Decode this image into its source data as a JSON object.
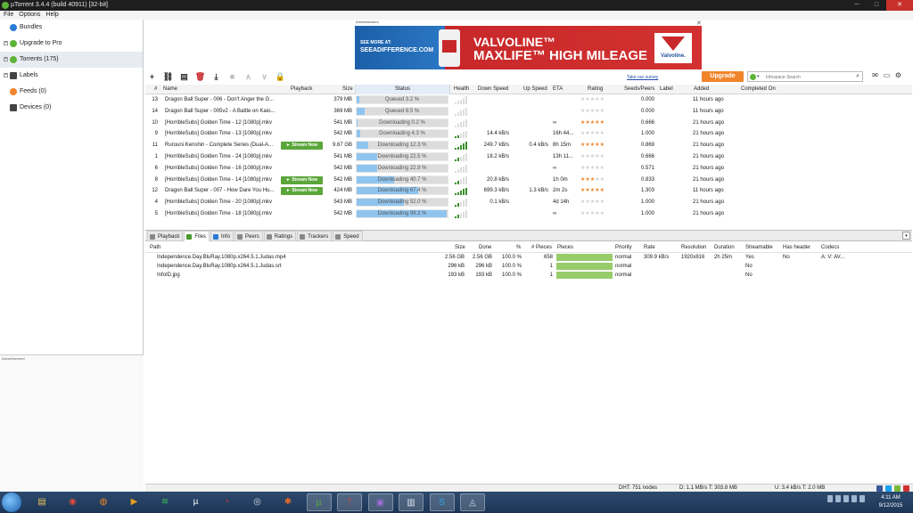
{
  "window": {
    "title": "µTorrent 3.4.4  (build 40911) [32-bit]",
    "min": "─",
    "max": "□",
    "close": "✕"
  },
  "menu": [
    "File",
    "Options",
    "Help"
  ],
  "sidebar": {
    "items": [
      {
        "label": "Bundles",
        "icon_color": "#2a7bd6"
      },
      {
        "label": "Upgrade to Pro",
        "icon_color": "#5cb338"
      },
      {
        "label": "Torrents (175)",
        "icon_color": "#5cb338"
      },
      {
        "label": "Labels",
        "icon_color": "#444444"
      },
      {
        "label": "Feeds (0)",
        "icon_color": "#f0852b"
      },
      {
        "label": "Devices (0)",
        "icon_color": "#444444"
      }
    ],
    "ad_label": "Advertisement"
  },
  "ad": {
    "label": "Advertisement",
    "close": "✕",
    "see_more": "SEE MORE AT:",
    "url": "SEEADIFFERENCE.COM",
    "brand": "VALVOLINE™",
    "tagline": "MAXLIFE™ HIGH MILEAGE",
    "logo": "Valvoline."
  },
  "survey_link": "Take our survey",
  "upgrade_button": "Upgrade",
  "search": {
    "placeholder": "Infospace Search"
  },
  "toolbar": {
    "icons": [
      "add-torrent-icon",
      "add-url-icon",
      "create-torrent-icon",
      "remove-icon",
      "download-icon",
      "stop-icon",
      "move-up-icon",
      "move-down-icon",
      "lock-icon"
    ]
  },
  "torrents": {
    "columns": [
      "#",
      "Name",
      "Playback",
      "Size",
      "Status",
      "Health",
      "Down Speed",
      "Up Speed",
      "ETA",
      "Rating",
      "Seeds/Peers",
      "Label",
      "Added",
      "Completed On"
    ],
    "stream_label": "► Stream Now",
    "rows": [
      {
        "num": "13",
        "name": "Dragon Ball Super - 006 - Don't Anger the G...",
        "stream": false,
        "size": "379 MB",
        "status": "Queued 3.2 %",
        "progress": 3.2,
        "health": 0,
        "down": "",
        "up": "",
        "eta": "",
        "rating": 0,
        "seeds": "0.000",
        "added": "11 hours ago"
      },
      {
        "num": "14",
        "name": "Dragon Ball Super - 005v2 - A Battle on Kaio...",
        "stream": false,
        "size": "369 MB",
        "status": "Queued 8.5 %",
        "progress": 8.5,
        "health": 0,
        "down": "",
        "up": "",
        "eta": "",
        "rating": 0,
        "seeds": "0.000",
        "added": "11 hours ago"
      },
      {
        "num": "10",
        "name": "[HorribleSubs] Golden Time - 12 [1080p].mkv",
        "stream": false,
        "size": "541 MB",
        "status": "Downloading 0.2 %",
        "progress": 0.2,
        "health": 0,
        "down": "",
        "up": "",
        "eta": "∞",
        "rating": 5,
        "seeds": "0.666",
        "added": "21 hours ago"
      },
      {
        "num": "9",
        "name": "[HorribleSubs] Golden Time - 13 [1080p].mkv",
        "stream": false,
        "size": "542 MB",
        "status": "Downloading 4.3 %",
        "progress": 4.3,
        "health": 2,
        "down": "14.4 kB/s",
        "up": "",
        "eta": "16h 44...",
        "rating": 0,
        "seeds": "1.000",
        "added": "21 hours ago"
      },
      {
        "num": "11",
        "name": "Rurouni Kenshin - Complete Series (Dual-A...",
        "stream": true,
        "size": "9.67 GB",
        "status": "Downloading 12.3 %",
        "progress": 12.3,
        "health": 5,
        "down": "249.7 kB/s",
        "up": "0.4 kB/s",
        "eta": "8h 15m",
        "rating": 5,
        "seeds": "0.869",
        "added": "21 hours ago"
      },
      {
        "num": "1",
        "name": "[HorribleSubs] Golden Time - 24 [1080p].mkv",
        "stream": false,
        "size": "541 MB",
        "status": "Downloading 22.5 %",
        "progress": 22.5,
        "health": 2,
        "down": "18.2 kB/s",
        "up": "",
        "eta": "13h 11...",
        "rating": 0,
        "seeds": "0.666",
        "added": "21 hours ago"
      },
      {
        "num": "6",
        "name": "[HorribleSubs] Golden Time - 16 [1080p].mkv",
        "stream": false,
        "size": "542 MB",
        "status": "Downloading 22.9 %",
        "progress": 22.9,
        "health": 0,
        "down": "",
        "up": "",
        "eta": "∞",
        "rating": 0,
        "seeds": "0.571",
        "added": "21 hours ago"
      },
      {
        "num": "8",
        "name": "[HorribleSubs] Golden Time - 14 [1080p].mkv",
        "stream": true,
        "size": "542 MB",
        "status": "Downloading 40.7 %",
        "progress": 40.7,
        "health": 2,
        "down": "20.8 kB/s",
        "up": "",
        "eta": "1h 0m",
        "rating": 3,
        "seeds": "0.833",
        "added": "21 hours ago"
      },
      {
        "num": "12",
        "name": "Dragon Ball Super - 007 - How Dare You Hu...",
        "stream": true,
        "size": "424 MB",
        "status": "Downloading 67.4 %",
        "progress": 67.4,
        "health": 5,
        "down": "699.3 kB/s",
        "up": "1.3 kB/s",
        "eta": "2m 2s",
        "rating": 5,
        "seeds": "1.303",
        "added": "11 hours ago"
      },
      {
        "num": "4",
        "name": "[HorribleSubs] Golden Time - 20 [1080p].mkv",
        "stream": false,
        "size": "543 MB",
        "status": "Downloading 52.0 %",
        "progress": 52.0,
        "health": 2,
        "down": "0.1 kB/s",
        "up": "",
        "eta": "4d 14h",
        "rating": 0,
        "seeds": "1.000",
        "added": "21 hours ago"
      },
      {
        "num": "5",
        "name": "[HorribleSubs] Golden Time - 18 [1080p].mkv",
        "stream": false,
        "size": "542 MB",
        "status": "Downloading 99.2 %",
        "progress": 99.2,
        "health": 2,
        "down": "",
        "up": "",
        "eta": "∞",
        "rating": 0,
        "seeds": "1.000",
        "added": "21 hours ago"
      }
    ]
  },
  "tabs": [
    {
      "label": "Playback",
      "icon_color": "#888888",
      "active": false
    },
    {
      "label": "Files",
      "icon_color": "#4a9a2c",
      "active": true
    },
    {
      "label": "Info",
      "icon_color": "#2a7bd6",
      "active": false
    },
    {
      "label": "Peers",
      "icon_color": "#888888",
      "active": false
    },
    {
      "label": "Ratings",
      "icon_color": "#888888",
      "active": false
    },
    {
      "label": "Trackers",
      "icon_color": "#888888",
      "active": false
    },
    {
      "label": "Speed",
      "icon_color": "#888888",
      "active": false
    }
  ],
  "files": {
    "columns": [
      "Path",
      "Size",
      "Done",
      "%",
      "# Pieces",
      "Pieces",
      "Priority",
      "Rate",
      "Resolution",
      "Duration",
      "Streamable",
      "Has header",
      "Codecs"
    ],
    "rows": [
      {
        "path": "Independence.Day.BluRay.1080p.x264.5.1.Judas.mp4",
        "size": "2.56 GB",
        "done": "2.56 GB",
        "pct": "100.0 %",
        "pieces_n": "658",
        "pieces_fill": 1.0,
        "priority": "normal",
        "rate": "309.9 kB/s",
        "resolution": "1920x816",
        "duration": "2h 25m",
        "streamable": "Yes",
        "header": "No",
        "codecs": "A:  V: AV..."
      },
      {
        "path": "Independence.Day.BluRay.1080p.x264.5.1.Judas.srt",
        "size": "296 kB",
        "done": "296 kB",
        "pct": "100.0 %",
        "pieces_n": "1",
        "pieces_fill": 1.0,
        "priority": "normal",
        "rate": "",
        "resolution": "",
        "duration": "",
        "streamable": "No",
        "header": "",
        "codecs": ""
      },
      {
        "path": "InfoID.jpg",
        "size": "193 kB",
        "done": "193 kB",
        "pct": "100.0 %",
        "pieces_n": "1",
        "pieces_fill": 1.0,
        "priority": "normal",
        "rate": "",
        "resolution": "",
        "duration": "",
        "streamable": "No",
        "header": "",
        "codecs": ""
      }
    ]
  },
  "status": {
    "dht": "DHT: 751 nodes",
    "down": "D: 1.1 MB/s T: 303.8 MB",
    "up": "U: 3.4 kB/s T: 2.0 MB"
  },
  "taskbar": {
    "apps": [
      {
        "icon": "explorer-icon",
        "glyph": "▤",
        "color": "#e8c15a"
      },
      {
        "icon": "chrome-icon",
        "glyph": "◉",
        "color": "#e34b3b"
      },
      {
        "icon": "firefox-icon",
        "glyph": "◍",
        "color": "#f08a24"
      },
      {
        "icon": "media-player-icon",
        "glyph": "▶",
        "color": "#e5a020"
      },
      {
        "icon": "spotify-icon",
        "glyph": "≋",
        "color": "#3cc35a"
      },
      {
        "icon": "utorrent-app-icon",
        "glyph": "µ",
        "color": "#ffffff"
      },
      {
        "icon": "app-icon",
        "glyph": "◔",
        "color": "#cc3333"
      },
      {
        "icon": "steam-icon",
        "glyph": "◎",
        "color": "#cfd8e3"
      },
      {
        "icon": "tool-icon",
        "glyph": "✱",
        "color": "#e86a2a"
      },
      {
        "icon": "utorrent-running-icon",
        "glyph": "µ",
        "color": "#5cb338"
      },
      {
        "icon": "red-app-icon",
        "glyph": "ᛉ",
        "color": "#e04040"
      },
      {
        "icon": "purple-app-icon",
        "glyph": "▣",
        "color": "#9b6bd6"
      },
      {
        "icon": "doc-icon",
        "glyph": "▥",
        "color": "#dde6f0"
      },
      {
        "icon": "skype-icon",
        "glyph": "S",
        "color": "#2aa8e8"
      },
      {
        "icon": "paint-icon",
        "glyph": "◬",
        "color": "#cfd8e3"
      }
    ],
    "time": "4:11 AM",
    "date": "9/12/2015"
  }
}
